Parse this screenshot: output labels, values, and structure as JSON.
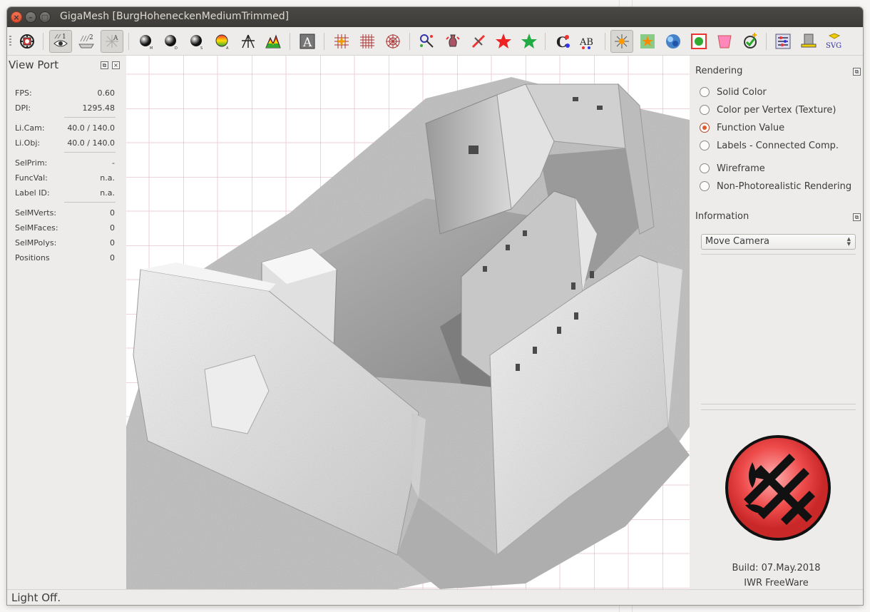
{
  "window": {
    "title": "GigaMesh [BurgHoheneckenMediumTrimmed]",
    "close_glyph": "×",
    "min_glyph": "–",
    "max_glyph": "□"
  },
  "toolbar": {
    "icons": [
      "camera-target-icon",
      "light-1-icon",
      "light-2-icon",
      "light-axis-icon",
      "sphere-m-icon",
      "sphere-d-icon",
      "sphere-s-icon",
      "sphere-colormap-icon",
      "axis-tripod-icon",
      "histogram-icon",
      "text-a-icon",
      "grid-plus-icon",
      "grid-icon",
      "polar-grid-icon",
      "select-magic-icon",
      "select-vase-icon",
      "select-slash-icon",
      "star-red-icon",
      "star-green-icon",
      "labels-c-icon",
      "labels-ab-icon",
      "sparkle-icon",
      "star-box-icon",
      "blue-blobs-icon",
      "green-blob-icon",
      "cup-icon",
      "check-plus-icon",
      "sliders-icon",
      "hat-icon",
      "svg-export-icon"
    ]
  },
  "left_panel": {
    "title": "View Port",
    "rows": [
      {
        "key": "FPS:",
        "value": "0.60"
      },
      {
        "key": "DPI:",
        "value": "1295.48"
      },
      {
        "key": "Li.Cam:",
        "value": "40.0 / 140.0"
      },
      {
        "key": "Li.Obj:",
        "value": "40.0 / 140.0"
      },
      {
        "key": "SelPrim:",
        "value": "-"
      },
      {
        "key": "FuncVal:",
        "value": "n.a."
      },
      {
        "key": "Label ID:",
        "value": "n.a."
      },
      {
        "key": "SelMVerts:",
        "value": "0"
      },
      {
        "key": "SelMFaces:",
        "value": "0"
      },
      {
        "key": "SelMPolys:",
        "value": "0"
      },
      {
        "key": "Positions",
        "value": "0"
      }
    ]
  },
  "right_panel": {
    "rendering_title": "Rendering",
    "options": [
      {
        "label": "Solid Color",
        "selected": false
      },
      {
        "label": "Color per Vertex (Texture)",
        "selected": false
      },
      {
        "label": "Function Value",
        "selected": true
      },
      {
        "label": "Labels - Connected Comp.",
        "selected": false
      },
      {
        "label": "Wireframe",
        "selected": false
      },
      {
        "label": "Non-Photorealistic Rendering",
        "selected": false
      }
    ],
    "information_title": "Information",
    "combo_value": "Move Camera",
    "build": "Build: 07.May.2018",
    "license": "IWR FreeWare"
  },
  "status": {
    "text": "Light Off."
  },
  "colors": {
    "accent_radio": "#e05a30",
    "logo_red": "#ee4b4b",
    "grid_line": "#e9c9cd"
  }
}
